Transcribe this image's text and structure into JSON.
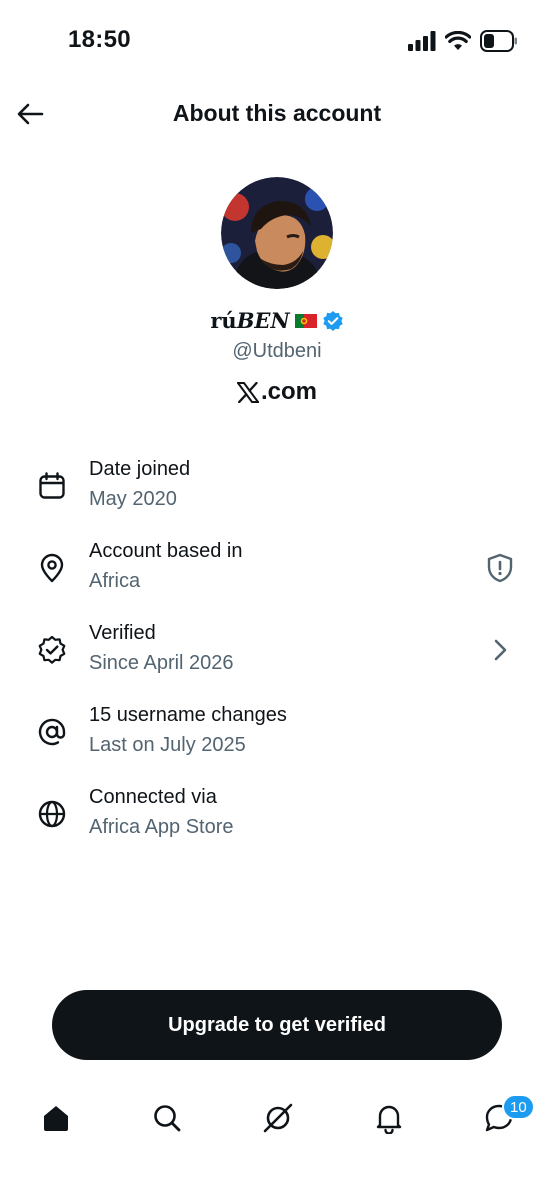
{
  "status_bar": {
    "time": "18:50",
    "icons": [
      "signal-icon",
      "wifi-icon",
      "battery-icon"
    ]
  },
  "header": {
    "back_icon": "arrow-left-icon",
    "title": "About this account"
  },
  "profile": {
    "display_name_upright": "rú",
    "display_name_italic": "BEN",
    "flag": "portugal-flag-icon",
    "verified_badge": "verified-badge-icon",
    "handle": "@Utdbeni",
    "site_logo": "X",
    "site_suffix": ".com"
  },
  "info_items": [
    {
      "icon": "calendar-icon",
      "title": "Date joined",
      "subtitle": "May 2020"
    },
    {
      "icon": "location-pin-icon",
      "title": "Account based in",
      "subtitle": "Africa",
      "right_icon": "shield-alert-icon"
    },
    {
      "icon": "verified-badge-outline-icon",
      "title": "Verified",
      "subtitle": "Since April 2026",
      "right_icon": "chevron-right-icon"
    },
    {
      "icon": "at-sign-icon",
      "title": "15 username changes",
      "subtitle": "Last on July 2025"
    },
    {
      "icon": "globe-icon",
      "title": "Connected via",
      "subtitle": "Africa App Store"
    }
  ],
  "cta": {
    "label": "Upgrade to get verified"
  },
  "bottom_nav": {
    "items": [
      "home-icon",
      "search-icon",
      "grok-icon",
      "notifications-icon",
      "messages-icon"
    ],
    "messages_badge": "10"
  },
  "colors": {
    "primary_text": "#0f1419",
    "secondary_text": "#536471",
    "accent_blue": "#1d9bf0",
    "button_bg": "#0f1419"
  }
}
